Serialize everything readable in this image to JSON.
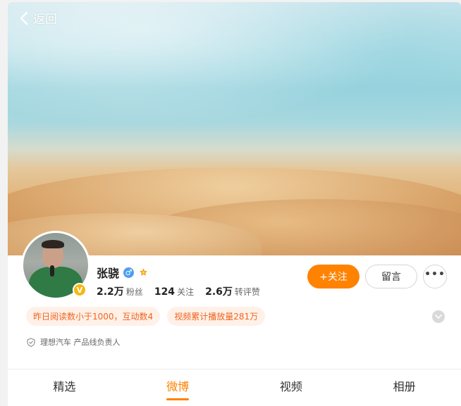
{
  "header": {
    "back_label": "返回"
  },
  "profile": {
    "name": "张骁",
    "gender_symbol": "♂",
    "verified_symbol": "V",
    "stats": [
      {
        "value": "2.2万",
        "label": "粉丝"
      },
      {
        "value": "124",
        "label": "关注"
      },
      {
        "value": "2.6万",
        "label": "转评赞"
      }
    ],
    "description": "理想汽车 产品线负责人"
  },
  "actions": {
    "follow_label": "+关注",
    "message_label": "留言",
    "more_label": "•••"
  },
  "tags": [
    "昨日阅读数小于1000，互动数4",
    "视频累计播放量281万"
  ],
  "tabs": [
    {
      "label": "精选",
      "active": false
    },
    {
      "label": "微博",
      "active": true
    },
    {
      "label": "视频",
      "active": false
    },
    {
      "label": "相册",
      "active": false
    }
  ],
  "colors": {
    "accent": "#ff8200",
    "tag_text": "#f0641e",
    "tag_bg": "#fff1e8",
    "verified": "#f5b712",
    "gender": "#4f9ef0"
  },
  "icons": [
    "back-chevron-icon",
    "verified-icon",
    "gender-male-icon",
    "fan-badge-icon",
    "more-icon",
    "expand-chevron-icon",
    "shield-icon"
  ]
}
